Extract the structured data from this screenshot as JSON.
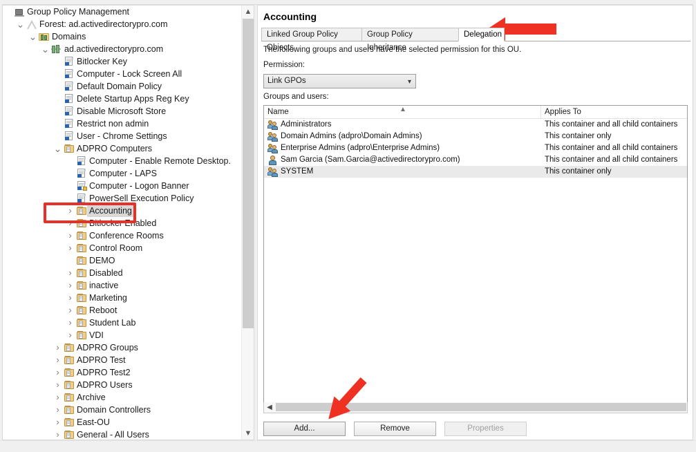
{
  "window": {
    "title": "Group Policy Management"
  },
  "tree": {
    "items": [
      {
        "label": "Group Policy Management",
        "icon": "console-root-icon",
        "depth": 0,
        "twisty": "none",
        "type": "root"
      },
      {
        "label": "Forest: ad.activedirectorypro.com",
        "icon": "forest-icon",
        "depth": 1,
        "twisty": "expanded",
        "type": "forest"
      },
      {
        "label": "Domains",
        "icon": "domains-icon",
        "depth": 2,
        "twisty": "expanded",
        "type": "domains"
      },
      {
        "label": "ad.activedirectorypro.com",
        "icon": "domain-icon",
        "depth": 3,
        "twisty": "expanded",
        "type": "domain"
      },
      {
        "label": "Bitlocker Key",
        "icon": "gpo-icon",
        "depth": 4,
        "twisty": "none",
        "type": "gpo"
      },
      {
        "label": "Computer - Lock Screen All",
        "icon": "gpo-icon",
        "depth": 4,
        "twisty": "none",
        "type": "gpo"
      },
      {
        "label": "Default Domain Policy",
        "icon": "gpo-icon",
        "depth": 4,
        "twisty": "none",
        "type": "gpo"
      },
      {
        "label": "Delete Startup Apps Reg Key",
        "icon": "gpo-icon",
        "depth": 4,
        "twisty": "none",
        "type": "gpo"
      },
      {
        "label": "Disable Microsoft Store",
        "icon": "gpo-icon",
        "depth": 4,
        "twisty": "none",
        "type": "gpo"
      },
      {
        "label": "Restrict non admin",
        "icon": "gpo-icon",
        "depth": 4,
        "twisty": "none",
        "type": "gpo"
      },
      {
        "label": "User - Chrome Settings",
        "icon": "gpo-icon",
        "depth": 4,
        "twisty": "none",
        "type": "gpo"
      },
      {
        "label": "ADPRO Computers",
        "icon": "ou-icon",
        "depth": 4,
        "twisty": "expanded",
        "type": "ou"
      },
      {
        "label": "Computer - Enable Remote Desktop.",
        "icon": "gpo-icon",
        "depth": 5,
        "twisty": "none",
        "type": "gpo"
      },
      {
        "label": "Computer - LAPS",
        "icon": "gpo-icon",
        "depth": 5,
        "twisty": "none",
        "type": "gpo"
      },
      {
        "label": "Computer - Logon Banner",
        "icon": "gpo-locked-icon",
        "depth": 5,
        "twisty": "none",
        "type": "gpo"
      },
      {
        "label": "PowerSell Execution Policy",
        "icon": "gpo-icon",
        "depth": 5,
        "twisty": "none",
        "type": "gpo"
      },
      {
        "label": "Accounting",
        "icon": "ou-icon",
        "depth": 5,
        "twisty": "collapsed",
        "type": "ou",
        "selected": true
      },
      {
        "label": "Bitlocker Enabled",
        "icon": "ou-icon",
        "depth": 5,
        "twisty": "collapsed",
        "type": "ou"
      },
      {
        "label": "Conference Rooms",
        "icon": "ou-icon",
        "depth": 5,
        "twisty": "collapsed",
        "type": "ou"
      },
      {
        "label": "Control Room",
        "icon": "ou-icon",
        "depth": 5,
        "twisty": "collapsed",
        "type": "ou"
      },
      {
        "label": "DEMO",
        "icon": "ou-icon",
        "depth": 5,
        "twisty": "none",
        "type": "ou"
      },
      {
        "label": "Disabled",
        "icon": "ou-icon",
        "depth": 5,
        "twisty": "collapsed",
        "type": "ou"
      },
      {
        "label": "inactive",
        "icon": "ou-icon",
        "depth": 5,
        "twisty": "collapsed",
        "type": "ou"
      },
      {
        "label": "Marketing",
        "icon": "ou-icon",
        "depth": 5,
        "twisty": "collapsed",
        "type": "ou"
      },
      {
        "label": "Reboot",
        "icon": "ou-icon",
        "depth": 5,
        "twisty": "collapsed",
        "type": "ou"
      },
      {
        "label": "Student Lab",
        "icon": "ou-icon",
        "depth": 5,
        "twisty": "collapsed",
        "type": "ou"
      },
      {
        "label": "VDI",
        "icon": "ou-icon",
        "depth": 5,
        "twisty": "collapsed",
        "type": "ou"
      },
      {
        "label": "ADPRO Groups",
        "icon": "ou-icon",
        "depth": 4,
        "twisty": "collapsed",
        "type": "ou"
      },
      {
        "label": "ADPRO Test",
        "icon": "ou-icon",
        "depth": 4,
        "twisty": "collapsed",
        "type": "ou"
      },
      {
        "label": "ADPRO Test2",
        "icon": "ou-icon",
        "depth": 4,
        "twisty": "collapsed",
        "type": "ou"
      },
      {
        "label": "ADPRO Users",
        "icon": "ou-icon",
        "depth": 4,
        "twisty": "collapsed",
        "type": "ou"
      },
      {
        "label": "Archive",
        "icon": "ou-icon",
        "depth": 4,
        "twisty": "collapsed",
        "type": "ou"
      },
      {
        "label": "Domain Controllers",
        "icon": "ou-icon",
        "depth": 4,
        "twisty": "collapsed",
        "type": "ou"
      },
      {
        "label": "East-OU",
        "icon": "ou-icon",
        "depth": 4,
        "twisty": "collapsed",
        "type": "ou"
      },
      {
        "label": "General - All Users",
        "icon": "ou-icon",
        "depth": 4,
        "twisty": "collapsed",
        "type": "ou"
      }
    ],
    "scrollbar": {
      "up_icon": "chevron-up-icon",
      "down_icon": "chevron-down-icon"
    }
  },
  "detail": {
    "title": "Accounting",
    "tabs": [
      {
        "label": "Linked Group Policy Objects",
        "active": false
      },
      {
        "label": "Group Policy Inheritance",
        "active": false
      },
      {
        "label": "Delegation",
        "active": true
      }
    ],
    "description": "The following groups and users have the selected permission for this OU.",
    "permission_label": "Permission:",
    "permission_value": "Link GPOs",
    "permission_chevron": "chevron-down-icon",
    "groups_label": "Groups and users:",
    "columns": [
      {
        "key": "name",
        "label": "Name",
        "sort": "ascending",
        "sort_icon": "sort-ascending-icon"
      },
      {
        "key": "applies_to",
        "label": "Applies To"
      }
    ],
    "rows": [
      {
        "name": "Administrators",
        "applies_to": "This container and all child containers",
        "icon": "group-icon",
        "selected": false
      },
      {
        "name": "Domain Admins (adpro\\Domain Admins)",
        "applies_to": "This container only",
        "icon": "group-icon",
        "selected": false
      },
      {
        "name": "Enterprise Admins (adpro\\Enterprise Admins)",
        "applies_to": "This container and all child containers",
        "icon": "group-icon",
        "selected": false
      },
      {
        "name": "Sam Garcia (Sam.Garcia@activedirectorypro.com)",
        "applies_to": "This container and all child containers",
        "icon": "user-icon",
        "selected": false
      },
      {
        "name": "SYSTEM",
        "applies_to": "This container only",
        "icon": "group-icon",
        "selected": true
      }
    ],
    "hscroll": {
      "left_icon": "chevron-left-icon"
    },
    "buttons": [
      {
        "label": "Add...",
        "enabled": true
      },
      {
        "label": "Remove",
        "enabled": true
      },
      {
        "label": "Properties",
        "enabled": false
      }
    ]
  },
  "annotations": {
    "highlight_color": "#e8302a",
    "highlight_target": "Accounting",
    "arrow_tab_target": "Delegation",
    "arrow_button_target": "Add..."
  }
}
